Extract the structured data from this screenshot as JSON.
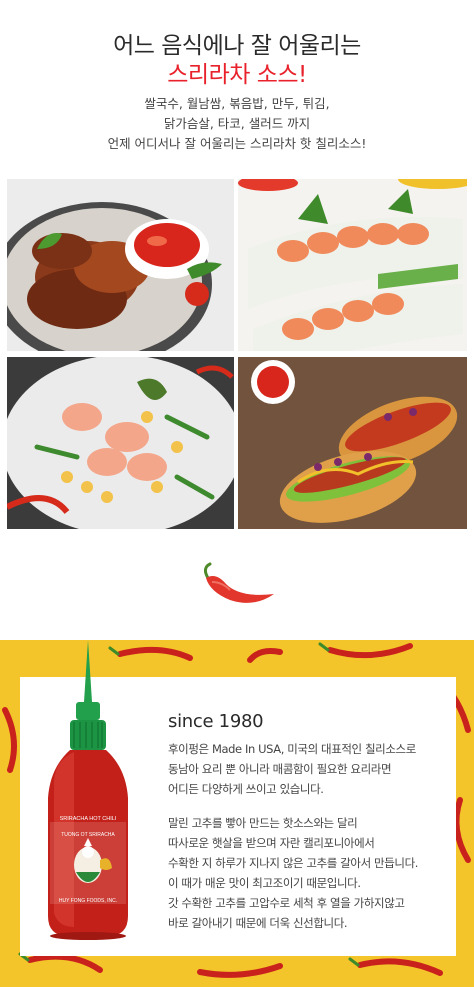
{
  "header": {
    "title_line1": "어느 음식에나 잘 어울리는",
    "title_line2": "스리라차 소스!",
    "desc_line1": "쌀국수, 월남쌈, 볶음밥, 만두, 튀김,",
    "desc_line2": "닭가슴살, 타코, 샐러드 까지",
    "desc_line3": "언제 어디서나 잘 어울리는 스리라차 핫 칠리소스!"
  },
  "photos": [
    {
      "icon": "grilled-chicken-with-sauce-image"
    },
    {
      "icon": "shrimp-rice-paper-rolls-image"
    },
    {
      "icon": "shrimp-salad-image"
    },
    {
      "icon": "hot-dogs-image"
    }
  ],
  "divider": {
    "icon": "chili-pepper-icon"
  },
  "about": {
    "since": "since 1980",
    "paragraph1": [
      "후이펑은 Made In USA, 미국의 대표적인 칠리소스로",
      "동남아 요리 뿐 아니라 매콤함이 필요한 요리라면",
      "어디든 다양하게 쓰이고 있습니다."
    ],
    "paragraph2": [
      "말린 고추를 빻아 만드는 핫소스와는 달리",
      "따사로운 햇살을 받으며 자란 캘리포니아에서",
      "수확한 지 하루가 지나지 않은 고추를 갈아서 만듭니다.",
      "이 때가 매운 맛이 최고조이기 때문입니다.",
      "갓 수확한 고추를 고압수로 세척 후 열을 가하지않고",
      "바로 갈아내기 때문에 더욱 신선합니다."
    ],
    "bottle_label": {
      "top": "SRIRACHA HOT CHILI",
      "brand": "TUONG OT SRIRACHA",
      "bottom": "HUY FONG FOODS, INC."
    }
  },
  "colors": {
    "accent_red": "#e8212b",
    "panel_yellow": "#f4c52a",
    "bottle_cap_green": "#1fa14a"
  }
}
